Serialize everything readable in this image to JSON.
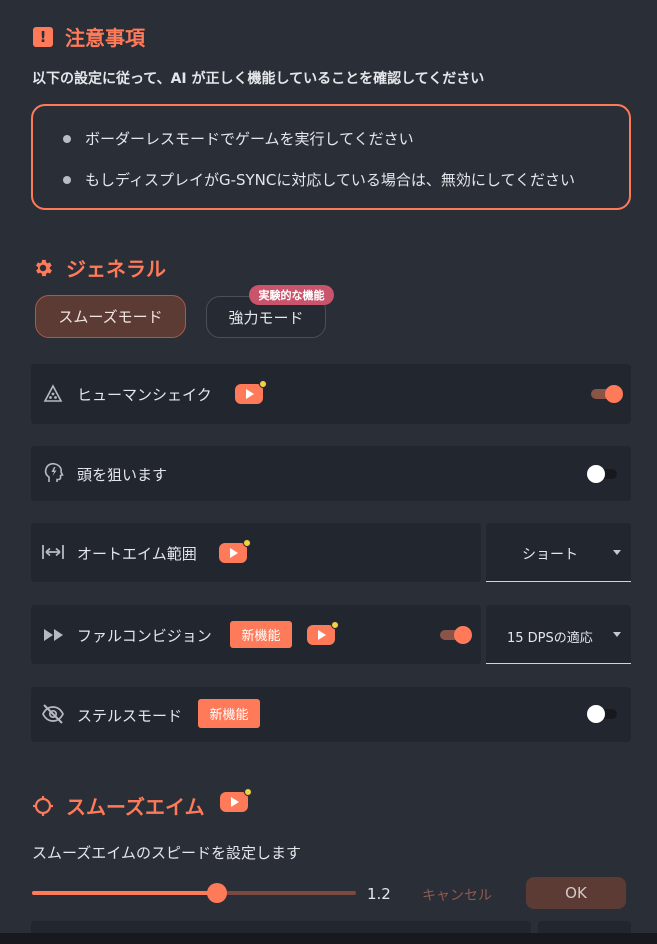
{
  "notice": {
    "title": "注意事項",
    "subtitle": "以下の設定に従って、AI が正しく機能していることを確認してください",
    "items": [
      "ボーダーレスモードでゲームを実行してください",
      "もしディスプレイがG-SYNCに対応している場合は、無効にしてください"
    ]
  },
  "general": {
    "title": "ジェネラル",
    "modes": [
      {
        "label": "スムーズモード",
        "active": true
      },
      {
        "label": "強力モード",
        "active": false,
        "badge": "実験的な機能"
      }
    ]
  },
  "settings": [
    {
      "icon": "triangle-dots-icon",
      "label": "ヒューマンシェイク",
      "video": true,
      "toggle": "on"
    },
    {
      "icon": "head-bolt-icon",
      "label": "頭を狙います",
      "toggle": "off"
    },
    {
      "icon": "range-arrows-icon",
      "label": "オートエイム範囲",
      "video": true,
      "select": "ショート"
    },
    {
      "icon": "fast-forward-icon",
      "label": "ファルコンビジョン",
      "badge": "新機能",
      "video": true,
      "toggle": "on",
      "select": "15 DPSの適応"
    },
    {
      "icon": "eye-off-icon",
      "label": "ステルスモード",
      "badge": "新機能",
      "toggle": "off"
    }
  ],
  "smooth_aim": {
    "title": "スムーズエイム",
    "description": "スムーズエイムのスピードを設定します",
    "value": "1.2",
    "value_fraction": 0.5,
    "cancel_label": "キャンセル",
    "ok_label": "OK"
  },
  "colors": {
    "accent": "#ff7a59",
    "background": "#2a2e37",
    "row_bg": "#22262e",
    "badge_pink": "#c9546c"
  }
}
